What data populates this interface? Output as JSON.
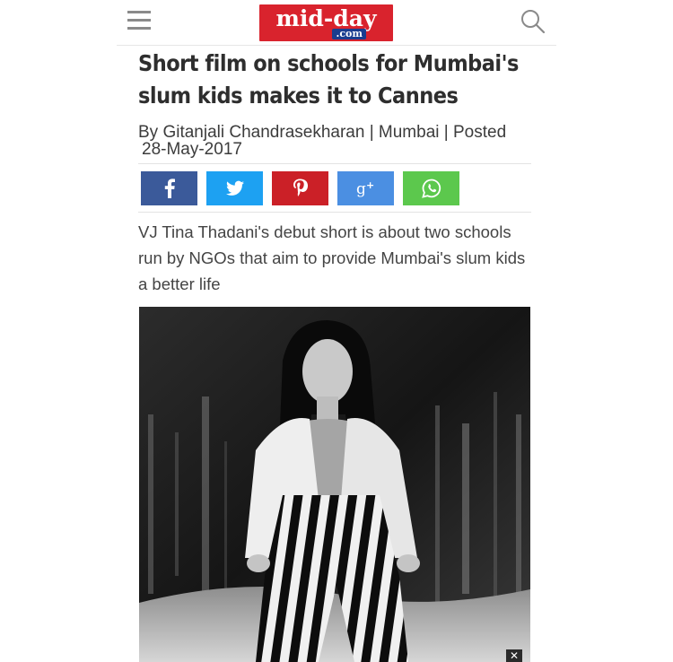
{
  "header": {
    "menu_icon": "hamburger-menu-icon",
    "logo_main": "mid-day",
    "logo_sub": ".com",
    "search_icon": "search-icon"
  },
  "article": {
    "title": "Short film on schools for Mumbai's slum kids makes it to Cannes",
    "byline": "By  Gitanjali Chandrasekharan | Mumbai | Posted",
    "date": "28-May-2017",
    "summary": "VJ Tina Thadani's debut short is about two schools run by NGOs that aim to provide Mumbai's slum kids a better life"
  },
  "share_buttons": [
    {
      "name": "facebook",
      "icon": "facebook-icon",
      "color": "#3b5a9a"
    },
    {
      "name": "twitter",
      "icon": "twitter-icon",
      "color": "#1da1f2"
    },
    {
      "name": "pinterest",
      "icon": "pinterest-icon",
      "color": "#cb2027"
    },
    {
      "name": "google-plus",
      "icon": "google-plus-icon",
      "color": "#4b8fe2"
    },
    {
      "name": "whatsapp",
      "icon": "whatsapp-icon",
      "color": "#5cc84d"
    }
  ],
  "image": {
    "description_icon": "article-photo"
  },
  "ad": {
    "close_label": "✕"
  },
  "colors": {
    "brand_red": "#d9232d",
    "title": "#2e2e2e",
    "text": "#444444"
  }
}
